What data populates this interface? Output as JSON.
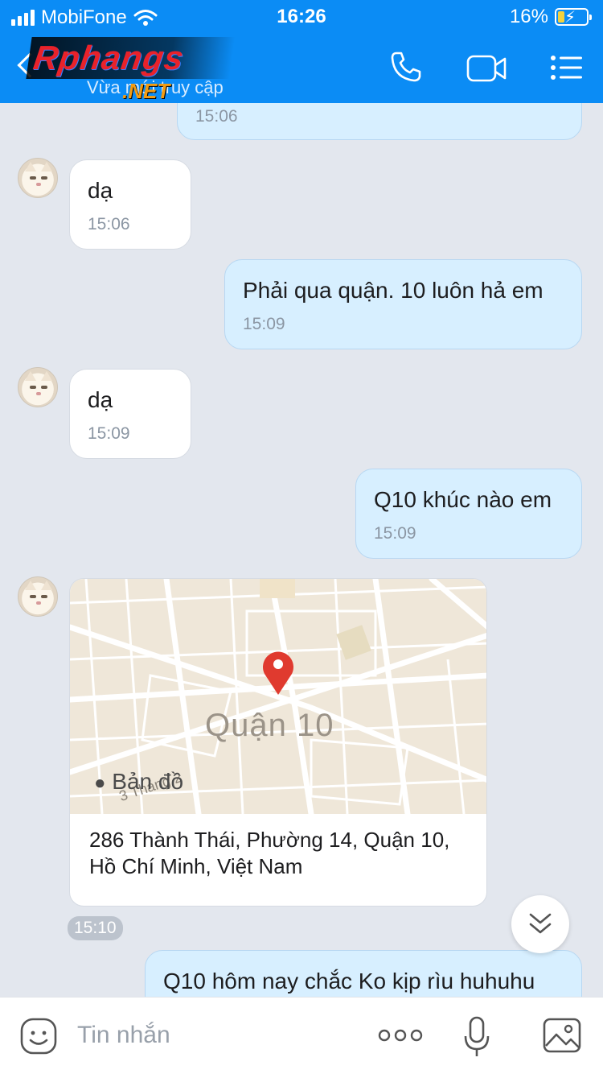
{
  "status": {
    "carrier": "MobiFone",
    "time": "16:26",
    "battery": "16%"
  },
  "header": {
    "logo": "Rphangs",
    "logo_suffix": ".NET",
    "subtitle": "Vừa mới truy cập",
    "icons": [
      "back-icon",
      "phone-icon",
      "video-camera-icon",
      "menu-list-icon"
    ]
  },
  "messages": [
    {
      "side": "out",
      "text": "",
      "time": "15:06"
    },
    {
      "side": "in",
      "text": "dạ",
      "time": "15:06"
    },
    {
      "side": "out",
      "text": "Phải qua quận. 10 luôn hả em",
      "time": "15:09"
    },
    {
      "side": "in",
      "text": "dạ",
      "time": "15:09"
    },
    {
      "side": "out",
      "text": "Q10 khúc nào em",
      "time": "15:09"
    },
    {
      "side": "out",
      "text": "Q10 hôm nay chắc Ko kịp rìu huhuhu",
      "time": ""
    }
  ],
  "location_card": {
    "map_label": "Quận 10",
    "map_brand": "Bản đồ",
    "street_label": "3 Tháng 2",
    "address": "286 Thành Thái, Phường 14, Quận 10, Hồ Chí Minh, Việt Nam",
    "time": "15:10"
  },
  "composer": {
    "placeholder": "Tin nhắn",
    "icons": [
      "sticker-icon",
      "more-icon",
      "microphone-icon",
      "image-icon"
    ]
  },
  "colors": {
    "header": "#0b8cf5",
    "chat_bg": "#e3e7ee",
    "out_bubble": "#d7efff",
    "in_bubble": "#ffffff",
    "pin": "#e03a2f"
  }
}
